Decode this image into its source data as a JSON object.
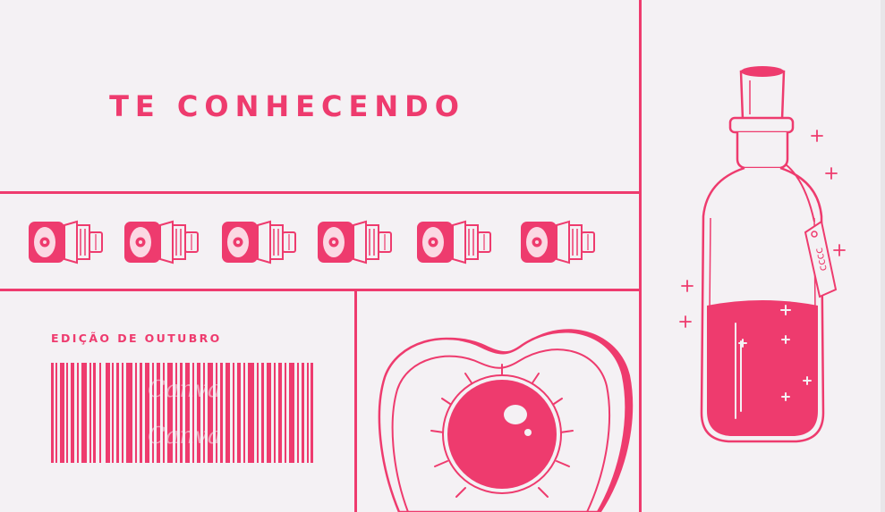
{
  "poster": {
    "title": "TE CONHECENDO",
    "edition": "EDIÇÃO DE OUTUBRO",
    "bottle_tag_text": "ɔɔɔɔ",
    "watermark": "Canva"
  },
  "colors": {
    "accent": "#ee3b6e",
    "background": "#f4f1f4",
    "pale_pink": "#fbd8e3"
  },
  "icons": [
    "film-roll-icon",
    "barcode-icon",
    "heart-eye-illustration",
    "potion-bottle-illustration"
  ]
}
